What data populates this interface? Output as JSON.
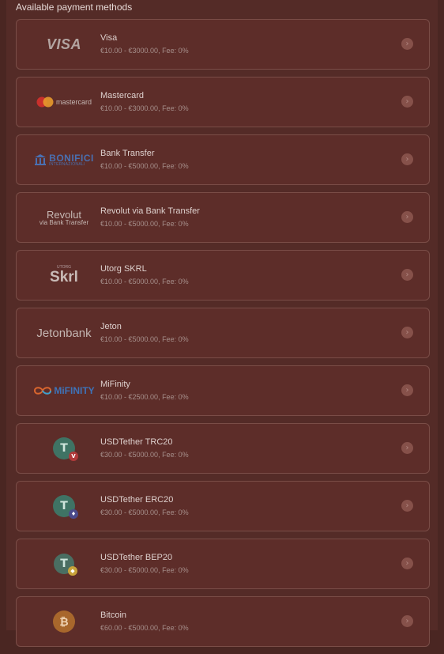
{
  "heading": "Available payment methods",
  "colors": {
    "card_bg": "#5d2d29",
    "card_border": "#7a4d47",
    "chevron_bg": "#86514a"
  },
  "methods": [
    {
      "name": "Visa",
      "limits": "€10.00 - €3000.00, Fee: 0%",
      "logo": "visa-logo",
      "logo_text": "VISA"
    },
    {
      "name": "Mastercard",
      "limits": "€10.00 - €3000.00, Fee: 0%",
      "logo": "mastercard-logo",
      "logo_text": "mastercard"
    },
    {
      "name": "Bank Transfer",
      "limits": "€10.00 - €5000.00, Fee: 0%",
      "logo": "bonifici-logo",
      "logo_text": "BONIFICI",
      "logo_subtext": "INTERNAZIONALI"
    },
    {
      "name": "Revolut via Bank Transfer",
      "limits": "€10.00 - €5000.00, Fee: 0%",
      "logo": "revolut-logo",
      "logo_text": "Revolut",
      "logo_subtext": "via Bank Transfer"
    },
    {
      "name": "Utorg SKRL",
      "limits": "€10.00 - €5000.00, Fee: 0%",
      "logo": "skrill-logo",
      "logo_text": "Skrl",
      "logo_subtext": "UTORG"
    },
    {
      "name": "Jeton",
      "limits": "€10.00 - €5000.00, Fee: 0%",
      "logo": "jetonbank-logo",
      "logo_text": "Jetonbank"
    },
    {
      "name": "MiFinity",
      "limits": "€10.00 - €2500.00, Fee: 0%",
      "logo": "mifinity-logo",
      "logo_text": "MiFINITY"
    },
    {
      "name": "USDTether TRC20",
      "limits": "€30.00 - €5000.00, Fee: 0%",
      "logo": "tether-trc20-icon",
      "badge_color": "#b03a3a"
    },
    {
      "name": "USDTether ERC20",
      "limits": "€30.00 - €5000.00, Fee: 0%",
      "logo": "tether-erc20-icon",
      "badge_color": "#4a4a8a"
    },
    {
      "name": "USDTether BEP20",
      "limits": "€30.00 - €5000.00, Fee: 0%",
      "logo": "tether-bep20-icon",
      "badge_color": "#c8a23a"
    },
    {
      "name": "Bitcoin",
      "limits": "€60.00 - €5000.00, Fee: 0%",
      "logo": "bitcoin-icon"
    }
  ]
}
